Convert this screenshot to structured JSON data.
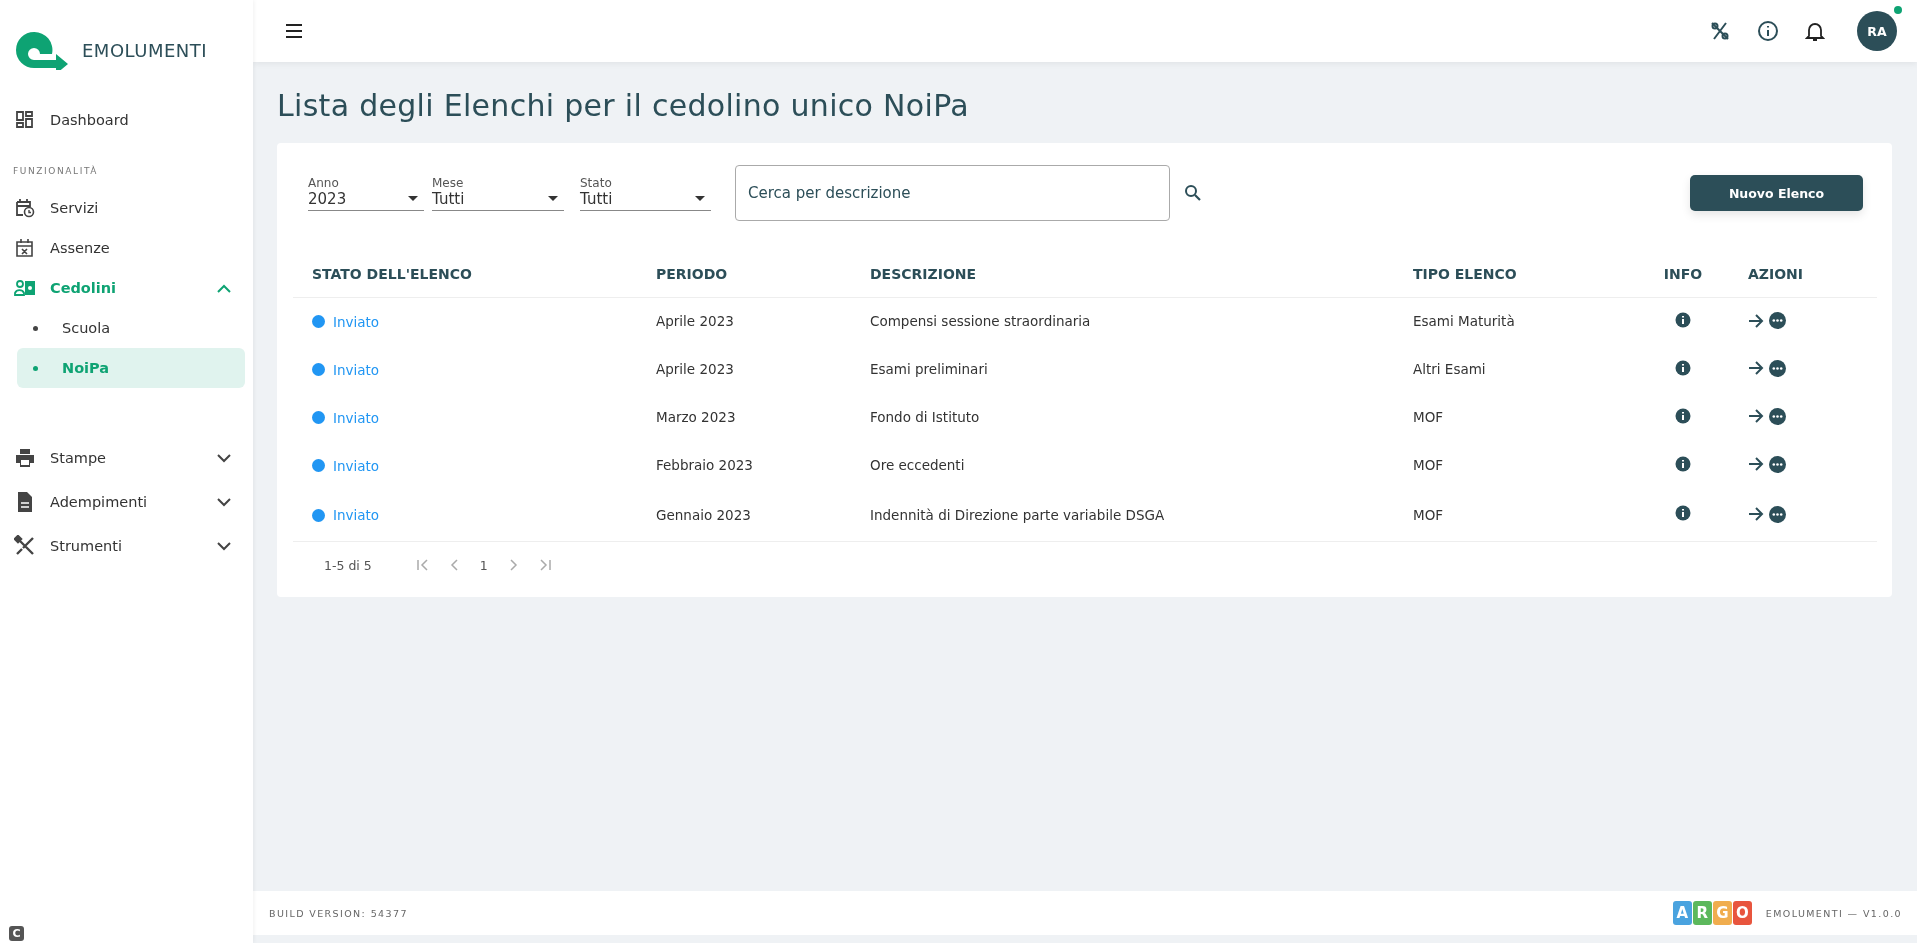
{
  "app": {
    "name": "EMOLUMENTI",
    "corner_badge": "C"
  },
  "sidebar": {
    "items": [
      {
        "label": "Dashboard",
        "selected": false
      },
      {
        "kind": "section",
        "label": "FUNZIONALITÀ"
      },
      {
        "label": "Servizi",
        "selected": false
      },
      {
        "label": "Assenze",
        "selected": false
      },
      {
        "label": "Cedolini",
        "selected": true,
        "expanded": true,
        "children": [
          {
            "label": "Scuola",
            "selected": false
          },
          {
            "label": "NoiPa",
            "selected": true
          }
        ]
      },
      {
        "kind": "gap"
      },
      {
        "label": "Stampe",
        "selected": false,
        "expanded": false
      },
      {
        "label": "Adempimenti",
        "selected": false,
        "expanded": false
      },
      {
        "label": "Strumenti",
        "selected": false,
        "expanded": false
      }
    ]
  },
  "header": {
    "avatar": "RA",
    "online": true
  },
  "page": {
    "title": "Lista degli Elenchi per il cedolino unico NoiPa"
  },
  "filters": [
    {
      "label": "Anno",
      "value": "2023"
    },
    {
      "label": "Mese",
      "value": "Tutti"
    },
    {
      "label": "Stato",
      "value": "Tutti"
    }
  ],
  "search": {
    "placeholder": "Cerca per descrizione"
  },
  "new_button": "Nuovo Elenco",
  "table": {
    "columns": [
      "STATO DELL'ELENCO",
      "PERIODO",
      "DESCRIZIONE",
      "TIPO ELENCO",
      "INFO",
      "AZIONI"
    ],
    "rows": [
      {
        "status": "Inviato",
        "color": "#2196f3",
        "period": "Aprile 2023",
        "description": "Compensi sessione straordinaria",
        "type": "Esami Maturità"
      },
      {
        "status": "Inviato",
        "color": "#2196f3",
        "period": "Aprile 2023",
        "description": "Esami preliminari",
        "type": "Altri Esami"
      },
      {
        "status": "Inviato",
        "color": "#2196f3",
        "period": "Marzo 2023",
        "description": "Fondo di Istituto",
        "type": "MOF"
      },
      {
        "status": "Inviato",
        "color": "#2196f3",
        "period": "Febbraio 2023",
        "description": "Ore eccedenti",
        "type": "MOF"
      },
      {
        "status": "Inviato",
        "color": "#2196f3",
        "period": "Gennaio 2023",
        "description": "Indennità di Direzione parte variabile DSGA",
        "type": "MOF"
      }
    ]
  },
  "pagination": {
    "range": "1-5 di 5",
    "page": "1"
  },
  "footer": {
    "build": "BUILD VERSION: 54377",
    "brand_letters": [
      {
        "letter": "A",
        "color": "#4aa3df"
      },
      {
        "letter": "R",
        "color": "#5cb85c"
      },
      {
        "letter": "G",
        "color": "#f0ad4e"
      },
      {
        "letter": "O",
        "color": "#e8553e"
      }
    ],
    "version": "EMOLUMENTI — V1.0.0"
  }
}
